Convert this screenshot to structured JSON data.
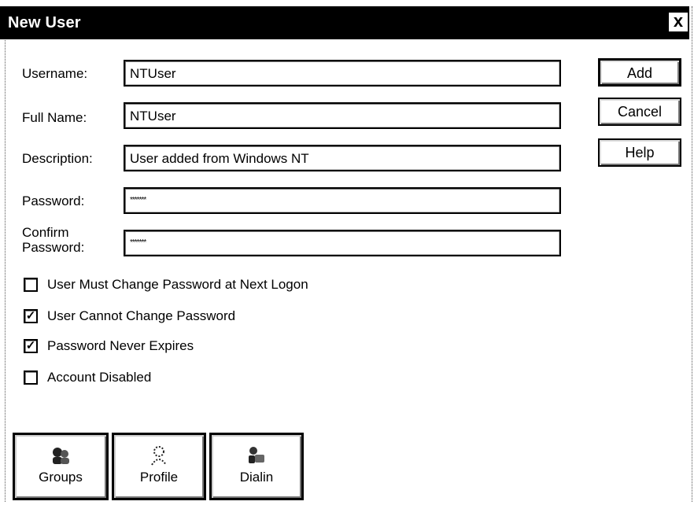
{
  "window": {
    "title": "New User",
    "close_glyph": "x"
  },
  "fields": {
    "username": {
      "label": "Username:",
      "value": "NTUser"
    },
    "full_name": {
      "label": "Full Name:",
      "value": "NTUser"
    },
    "description": {
      "label": "Description:",
      "value": "User added from Windows NT"
    },
    "password": {
      "label": "Password:",
      "value": "*******"
    },
    "confirm_password": {
      "label_line1": "Confirm",
      "label_line2": "Password:",
      "value": "*******"
    }
  },
  "buttons": {
    "add": "Add",
    "cancel": "Cancel",
    "help": "Help"
  },
  "checkboxes": [
    {
      "label": "User Must Change Password at Next Logon",
      "checked": false
    },
    {
      "label": "User Cannot Change Password",
      "checked": true
    },
    {
      "label": "Password Never Expires",
      "checked": true
    },
    {
      "label": "Account Disabled",
      "checked": false
    }
  ],
  "bottom_buttons": [
    {
      "label": "Groups",
      "icon": "groups-icon"
    },
    {
      "label": "Profile",
      "icon": "profile-icon"
    },
    {
      "label": "Dialin",
      "icon": "dialin-icon"
    }
  ]
}
